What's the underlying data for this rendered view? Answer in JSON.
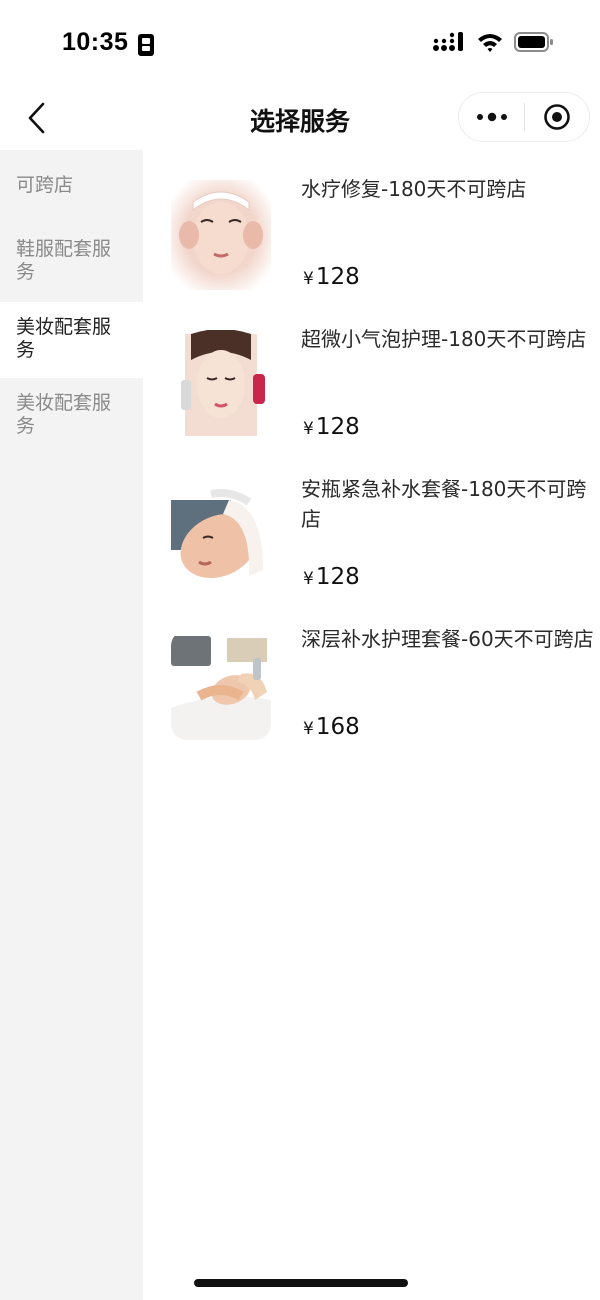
{
  "status_bar": {
    "time": "10:35"
  },
  "nav": {
    "title": "选择服务"
  },
  "sidebar": {
    "items": [
      {
        "label": "可跨店",
        "active": false
      },
      {
        "label": "鞋服配套服务",
        "active": false
      },
      {
        "label": "美妆配套服务",
        "active": true
      },
      {
        "label": "美妆配套服务",
        "active": false
      }
    ]
  },
  "products": [
    {
      "name": "水疗修复-180天不可跨店",
      "currency": "¥",
      "price": "128"
    },
    {
      "name": "超微小气泡护理-180天不可跨店",
      "currency": "¥",
      "price": "128"
    },
    {
      "name": "安瓶紧急补水套餐-180天不可跨店",
      "currency": "¥",
      "price": "128"
    },
    {
      "name": "深层补水护理套餐-60天不可跨店",
      "currency": "¥",
      "price": "168"
    }
  ],
  "colors": {
    "sidebar_bg": "#f3f3f3",
    "active_item_bg": "#ffffff",
    "inactive_text": "#8a8a8a",
    "active_text": "#222222"
  }
}
